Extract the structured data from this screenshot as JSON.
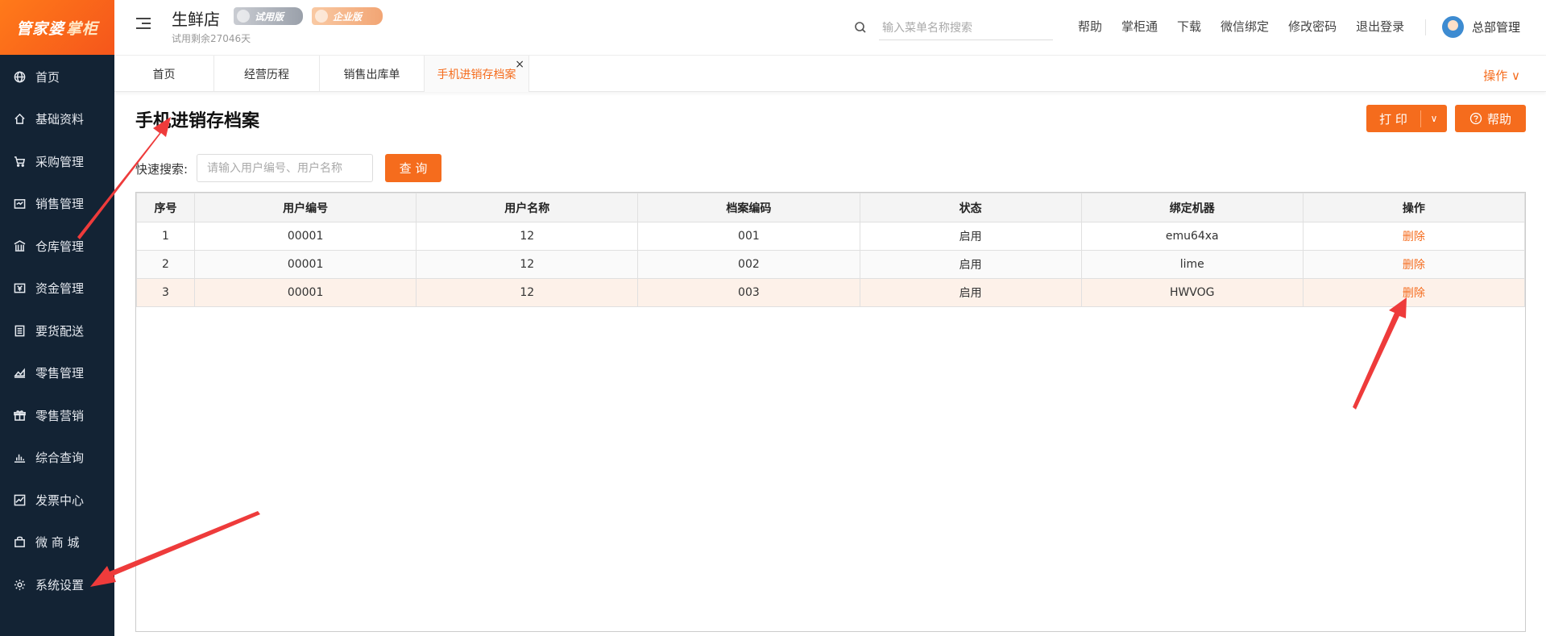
{
  "logo": {
    "part1": "管家婆",
    "part2": "掌柜"
  },
  "sidebar": {
    "items": [
      {
        "label": "首页",
        "icon": "globe-icon"
      },
      {
        "label": "基础资料",
        "icon": "home-icon"
      },
      {
        "label": "采购管理",
        "icon": "cart-icon"
      },
      {
        "label": "销售管理",
        "icon": "sales-icon"
      },
      {
        "label": "仓库管理",
        "icon": "warehouse-icon"
      },
      {
        "label": "资金管理",
        "icon": "money-icon"
      },
      {
        "label": "要货配送",
        "icon": "list-icon"
      },
      {
        "label": "零售管理",
        "icon": "chart-icon"
      },
      {
        "label": "零售营销",
        "icon": "gift-icon"
      },
      {
        "label": "综合查询",
        "icon": "bar-chart-icon"
      },
      {
        "label": "发票中心",
        "icon": "trend-icon"
      },
      {
        "label": "微 商 城",
        "icon": "bag-icon"
      },
      {
        "label": "系统设置",
        "icon": "gear-icon"
      }
    ]
  },
  "header": {
    "store_name": "生鲜店",
    "badge_trial": "试用版",
    "badge_enterprise": "企业版",
    "trial_remaining": "试用剩余27046天",
    "search_placeholder": "输入菜单名称搜索",
    "nav": [
      "帮助",
      "掌柜通",
      "下载",
      "微信绑定",
      "修改密码",
      "退出登录"
    ],
    "user_name": "总部管理"
  },
  "tabs": {
    "items": [
      "首页",
      "经营历程",
      "销售出库单",
      "手机进销存档案"
    ],
    "active_index": 3,
    "close_symbol": "×",
    "operation_label": "操作 ∨"
  },
  "main": {
    "title": "手机进销存档案",
    "print_label": "打 印",
    "help_label": "帮助",
    "quick_search_label": "快速搜索:",
    "quick_search_placeholder": "请输入用户编号、用户名称",
    "query_label": "查 询"
  },
  "table": {
    "headers": [
      "序号",
      "用户编号",
      "用户名称",
      "档案编码",
      "状态",
      "绑定机器",
      "操作"
    ],
    "rows": [
      [
        "1",
        "00001",
        "12",
        "001",
        "启用",
        "emu64xa",
        "删除"
      ],
      [
        "2",
        "00001",
        "12",
        "002",
        "启用",
        "lime",
        "删除"
      ],
      [
        "3",
        "00001",
        "12",
        "003",
        "启用",
        "HWVOG",
        "删除"
      ]
    ]
  },
  "colors": {
    "accent": "#f56c1d",
    "sidebar_bg": "#132334",
    "annotation_arrow": "#ee3b3b"
  }
}
